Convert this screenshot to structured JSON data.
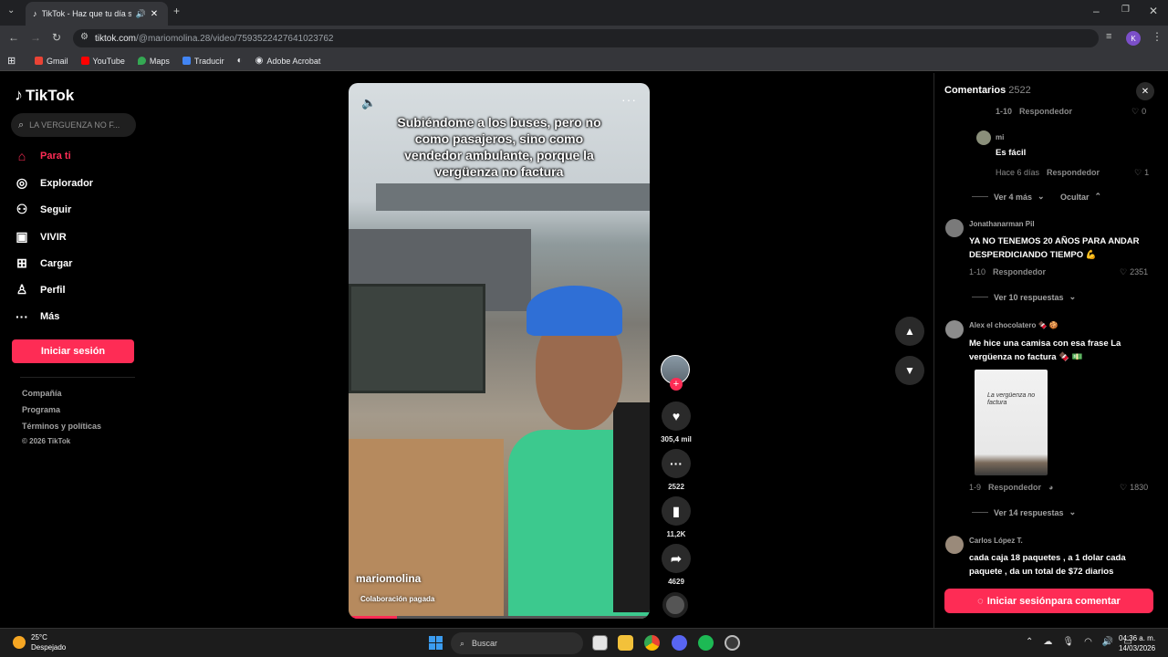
{
  "browser": {
    "tab_title": "TikTok - Haz que tu día sea",
    "url_host": "tiktok.com",
    "url_path": "/@mariomolina.28/video/7593522427641023762",
    "bookmarks": [
      "Gmail",
      "YouTube",
      "Maps",
      "Traducir",
      "Adobe Acrobat"
    ],
    "profile_initial": "K"
  },
  "sidebar": {
    "logo": "TikTok",
    "search_placeholder": "LA VERGUENZA NO F...",
    "items": [
      {
        "label": "Para ti",
        "icon": "home-icon",
        "active": true
      },
      {
        "label": "Explorador",
        "icon": "compass-icon"
      },
      {
        "label": "Seguir",
        "icon": "user-follow-icon"
      },
      {
        "label": "VIVIR",
        "icon": "live-icon"
      },
      {
        "label": "Cargar",
        "icon": "upload-icon"
      },
      {
        "label": "Perfil",
        "icon": "profile-icon"
      },
      {
        "label": "Más",
        "icon": "more-icon"
      }
    ],
    "login_button": "Iniciar sesión",
    "footer": [
      "Compañía",
      "Programa",
      "Términos y políticas",
      "© 2026 TikTok"
    ]
  },
  "video": {
    "caption": "Subiéndome a los buses, pero no como pasajeros, sino como vendedor ambulante, porque la vergüenza no factura",
    "username": "mariomolina",
    "collab": "Colaboración pagada",
    "progress": 0.16
  },
  "actions": {
    "likes": "305,4 mil",
    "comments": "2522",
    "saves": "11,2K",
    "shares": "4629"
  },
  "comments": {
    "title": "Comentarios",
    "count": "2522",
    "items": [
      {
        "meta_date": "1-10",
        "reply": "Respondedor",
        "likes": "0"
      },
      {
        "user": "mi",
        "text": "Es fácil",
        "meta_date": "Hace 6 días",
        "reply": "Respondedor",
        "likes": "1"
      },
      {
        "view_more": "Ver 4 más",
        "hide": "Ocultar"
      },
      {
        "user": "Jonathanarman Pil",
        "text": "YA NO TENEMOS 20 AÑOS PARA ANDAR DESPERDICIANDO TIEMPO 💪",
        "meta_date": "1-10",
        "reply": "Respondedor",
        "likes": "2351",
        "view_replies": "Ver 10 respuestas"
      },
      {
        "user": "Alex el chocolatero 🍫 🍪",
        "text": "Me hice una camisa con esa frase La vergüenza no factura 🍫 💵",
        "meta_date": "1-9",
        "reply": "Respondedor",
        "likes": "1830",
        "view_replies": "Ver 14 respuestas",
        "image_text": "La vergüenza no factura"
      },
      {
        "user": "Carlos López T.",
        "text": "cada caja 18 paquetes , a 1 dolar cada paquete , da un total de $72 diarios"
      }
    ],
    "login_button": "Iniciar sesiónpara comentar"
  },
  "taskbar": {
    "temp": "25°C",
    "weather": "Despejado",
    "search": "Buscar",
    "time": "04:36 a. m.",
    "date": "14/03/2026"
  }
}
